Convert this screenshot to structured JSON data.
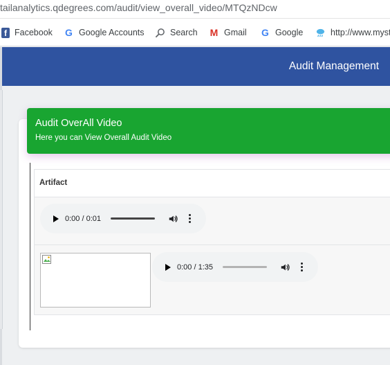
{
  "browser": {
    "url": "tailanalytics.qdegrees.com/audit/view_overall_video/MTQzNDcw",
    "bookmarks": [
      {
        "label": "Facebook",
        "icon": "facebook-icon"
      },
      {
        "label": "Google Accounts",
        "icon": "google-icon"
      },
      {
        "label": "Search",
        "icon": "search-icon"
      },
      {
        "label": "Gmail",
        "icon": "gmail-icon"
      },
      {
        "label": "Google",
        "icon": "google-icon"
      },
      {
        "label": "http://www.myst",
        "icon": "weather-icon"
      }
    ]
  },
  "app": {
    "title": "Audit Management"
  },
  "card": {
    "title": "Audit OverAll Video",
    "subtitle": "Here you can View Overall Audit Video",
    "table": {
      "header": "Artifact",
      "rows": [
        {
          "player": {
            "time": "0:00 / 0:01",
            "progress": 0
          }
        },
        {
          "image": "broken-image",
          "player": {
            "time": "0:00 / 1:35",
            "progress": 0
          }
        }
      ]
    }
  },
  "colors": {
    "header_blue": "#2f53a0",
    "card_header_green": "#19a531",
    "player_bg": "#f1f3f4"
  }
}
